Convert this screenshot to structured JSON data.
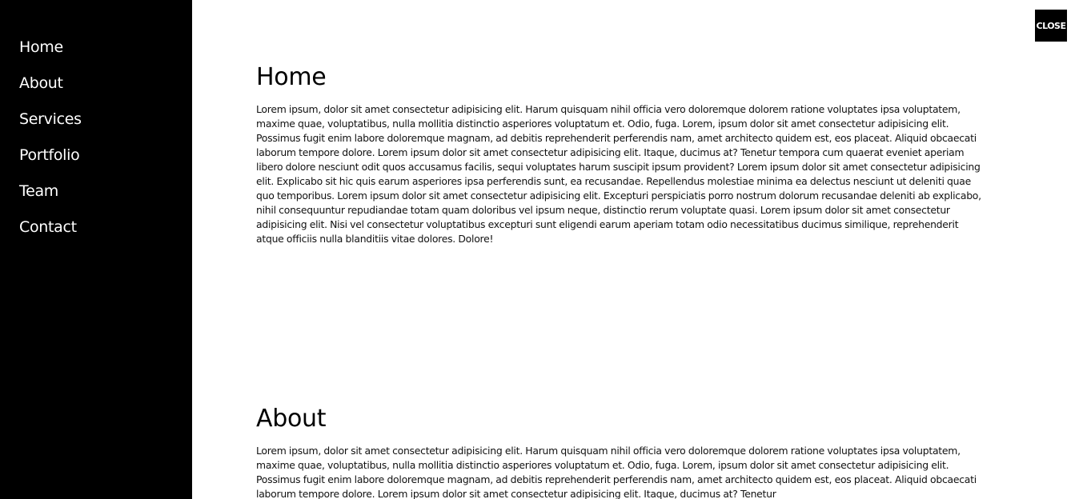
{
  "nav": {
    "items": [
      {
        "label": "Home"
      },
      {
        "label": "About"
      },
      {
        "label": "Services"
      },
      {
        "label": "Portfolio"
      },
      {
        "label": "Team"
      },
      {
        "label": "Contact"
      }
    ]
  },
  "close_button": {
    "label": "CLOSE"
  },
  "sections": [
    {
      "title": "Home",
      "body": "Lorem ipsum, dolor sit amet consectetur adipisicing elit. Harum quisquam nihil officia vero doloremque dolorem ratione voluptates ipsa voluptatem, maxime quae, voluptatibus, nulla mollitia distinctio asperiores voluptatum et. Odio, fuga. Lorem, ipsum dolor sit amet consectetur adipisicing elit. Possimus fugit enim labore doloremque magnam, ad debitis reprehenderit perferendis nam, amet architecto quidem est, eos placeat. Aliquid obcaecati laborum tempore dolore. Lorem ipsum dolor sit amet consectetur adipisicing elit. Itaque, ducimus at? Tenetur tempora cum quaerat eveniet aperiam libero dolore nesciunt odit quos accusamus facilis, sequi voluptates harum suscipit ipsum provident? Lorem ipsum dolor sit amet consectetur adipisicing elit. Explicabo sit hic quis earum asperiores ipsa perferendis sunt, ea recusandae. Repellendus molestiae minima ea delectus nesciunt ut deleniti quae quo temporibus. Lorem ipsum dolor sit amet consectetur adipisicing elit. Excepturi perspiciatis porro nostrum dolorum recusandae deleniti ab explicabo, nihil consequuntur repudiandae totam quam doloribus vel ipsum neque, distinctio rerum voluptate quasi. Lorem ipsum dolor sit amet consectetur adipisicing elit. Nisi vel consectetur voluptatibus excepturi sunt eligendi earum aperiam totam odio necessitatibus ducimus similique, reprehenderit atque officiis nulla blanditiis vitae dolores. Dolore!"
    },
    {
      "title": "About",
      "body": "Lorem ipsum, dolor sit amet consectetur adipisicing elit. Harum quisquam nihil officia vero doloremque dolorem ratione voluptates ipsa voluptatem, maxime quae, voluptatibus, nulla mollitia distinctio asperiores voluptatum et. Odio, fuga. Lorem, ipsum dolor sit amet consectetur adipisicing elit. Possimus fugit enim labore doloremque magnam, ad debitis reprehenderit perferendis nam, amet architecto quidem est, eos placeat. Aliquid obcaecati laborum tempore dolore. Lorem ipsum dolor sit amet consectetur adipisicing elit. Itaque, ducimus at? Tenetur"
    }
  ]
}
